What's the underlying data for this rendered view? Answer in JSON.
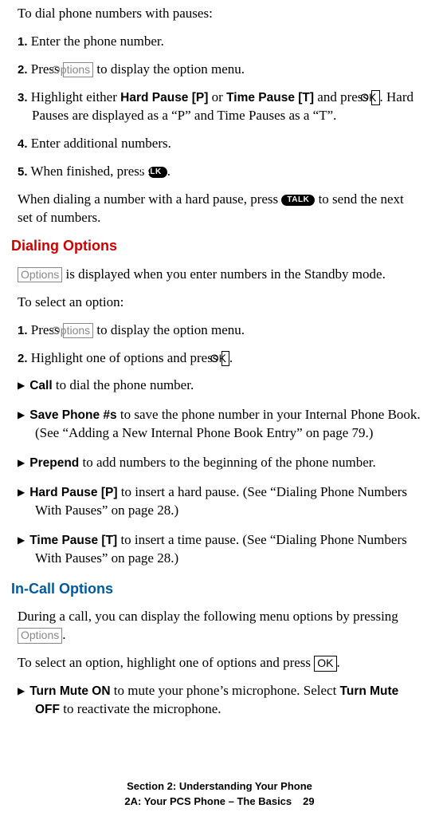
{
  "intro1": "To dial phone numbers with pauses:",
  "steps1": {
    "n1": "1.",
    "t1a": "Enter the phone number.",
    "n2": "2.",
    "t2a": "Press ",
    "k2": "Options",
    "t2b": " to display the option menu.",
    "n3": "3.",
    "t3a": "Highlight either ",
    "b3a": "Hard Pause [P]",
    "t3b": " or ",
    "b3b": "Time Pause [T]",
    "t3c": " and press ",
    "k3": "OK",
    "t3d": ". Hard Pauses are displayed as a “P” and Time Pauses as a “T”.",
    "n4": "4.",
    "t4a": "Enter additional numbers.",
    "n5": "5.",
    "t5a": "When finished, press ",
    "talk5": "TALK",
    "t5b": "."
  },
  "para1a": "When dialing a number with a hard pause, press ",
  "talk1": "TALK",
  "para1b": " to send the next set of numbers.",
  "h2a": "Dialing Options",
  "k_a": "Options",
  "para2": " is displayed when you enter numbers in the Standby mode.",
  "intro2": "To select an option:",
  "steps2": {
    "n1": "1.",
    "t1a": "Press ",
    "k1": "Options",
    "t1b": " to display the option menu.",
    "n2": "2.",
    "t2a": "Highlight one of options and press ",
    "k2": "OK",
    "t2b": "."
  },
  "bullets1": [
    {
      "b": "Call",
      "t": " to dial the phone number."
    },
    {
      "b": "Save Phone #s",
      "t": " to save the phone number in your Internal Phone Book. (See “Adding a New Internal Phone Book Entry” on page 79.)"
    },
    {
      "b": "Prepend",
      "t": " to add numbers to the beginning of the phone number."
    },
    {
      "b": "Hard Pause [P]",
      "t": " to insert a hard pause. (See “Dialing Phone Numbers With Pauses” on page 28.)"
    },
    {
      "b": "Time Pause [T]",
      "t": " to insert a time pause. (See “Dialing Phone Numbers With Pauses” on page 28.)"
    }
  ],
  "h2b": "In-Call Options",
  "para3a": "During a call, you can display the following menu options by pressing ",
  "k_b": "Options",
  "para3b": ".",
  "para4a": "To select an option, highlight one of options and press ",
  "k_c": "OK",
  "para4b": ".",
  "bullet2": {
    "b1": "Turn Mute ON",
    "t1": " to mute your phone’s microphone. Select ",
    "b2": "Turn Mute OFF",
    "t2": " to reactivate the microphone."
  },
  "footer": {
    "line1": "Section 2: Understanding Your Phone",
    "line2": "2A: Your PCS Phone – The Basics",
    "page": "29"
  },
  "tri": "▶"
}
